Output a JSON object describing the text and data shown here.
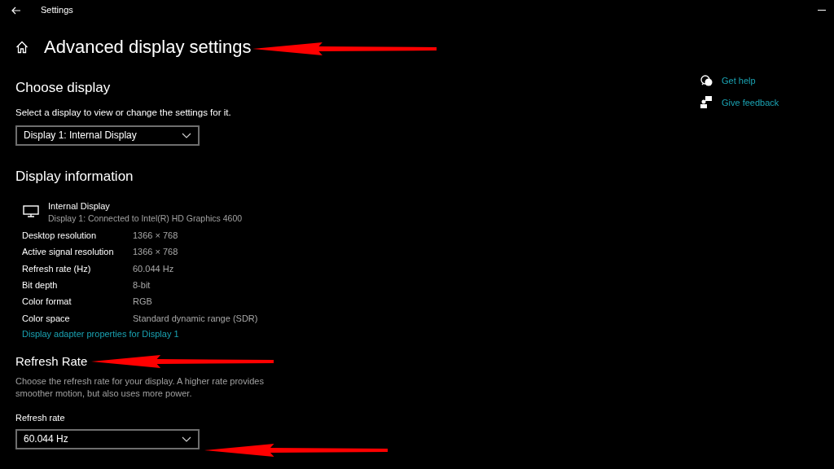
{
  "window": {
    "title": "Settings"
  },
  "page_title": "Advanced display settings",
  "choose_display": {
    "heading": "Choose display",
    "description": "Select a display to view or change the settings for it.",
    "dropdown": {
      "value": "Display 1: Internal Display"
    }
  },
  "display_information": {
    "heading": "Display information",
    "display_name": "Internal Display",
    "display_subtitle": "Display 1: Connected to Intel(R) HD Graphics 4600",
    "rows": [
      {
        "label": "Desktop resolution",
        "value": "1366 × 768"
      },
      {
        "label": "Active signal resolution",
        "value": "1366 × 768"
      },
      {
        "label": "Refresh rate (Hz)",
        "value": "60.044 Hz"
      },
      {
        "label": "Bit depth",
        "value": "8-bit"
      },
      {
        "label": "Color format",
        "value": "RGB"
      },
      {
        "label": "Color space",
        "value": "Standard dynamic range (SDR)"
      }
    ],
    "link": "Display adapter properties for Display 1"
  },
  "refresh_rate": {
    "heading": "Refresh Rate",
    "description": "Choose the refresh rate for your display. A higher rate provides smoother motion, but also uses more power.",
    "label": "Refresh rate",
    "dropdown": {
      "value": "60.044 Hz"
    }
  },
  "help_links": [
    {
      "kind": "help",
      "label": "Get help"
    },
    {
      "kind": "feedback",
      "label": "Give feedback"
    }
  ]
}
